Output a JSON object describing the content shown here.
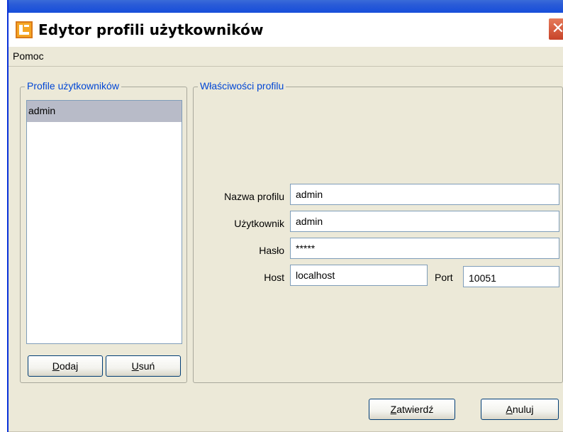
{
  "window": {
    "title": "Edytor profili użytkowników",
    "close_glyph": "✕",
    "app_icon": "app-logo-icon"
  },
  "menubar": {
    "items": [
      {
        "label": "Pomoc"
      }
    ]
  },
  "profiles": {
    "legend": "Profile użytkowników",
    "items": [
      {
        "label": "admin",
        "selected": true
      }
    ],
    "add_button": {
      "mnemonic": "D",
      "rest": "odaj"
    },
    "remove_button": {
      "mnemonic": "U",
      "rest": "suń"
    }
  },
  "properties": {
    "legend": "Właściwości profilu",
    "profile_name": {
      "label": "Nazwa profilu",
      "value": "admin"
    },
    "user": {
      "label": "Użytkownik",
      "value": "admin"
    },
    "password": {
      "label": "Hasło",
      "value": "*****"
    },
    "host": {
      "label": "Host",
      "value": "localhost"
    },
    "port": {
      "label": "Port",
      "value": "10051"
    }
  },
  "footer": {
    "ok_button": {
      "mnemonic": "Z",
      "rest": "atwierdź"
    },
    "cancel_button": {
      "mnemonic": "A",
      "rest": "nuluj"
    }
  },
  "colors": {
    "accent": "#0046d5",
    "selection": "#b8bbc8",
    "window_bg": "#ece9d8"
  }
}
